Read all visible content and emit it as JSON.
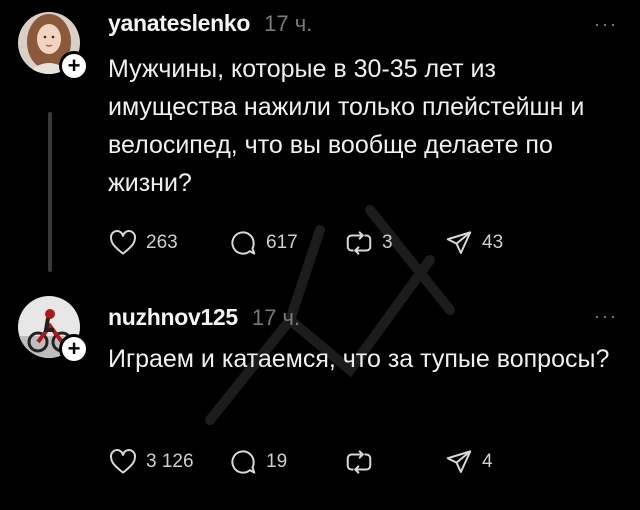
{
  "posts": [
    {
      "username": "yanateslenko",
      "time": "17 ч.",
      "text": "Мужчины, которые в 30-35 лет из имущества нажили только плейстейшн и велосипед, что вы вообще делаете по жизни?",
      "likes": "263",
      "replies": "617",
      "reposts": "3",
      "shares": "43"
    },
    {
      "username": "nuzhnov125",
      "time": "17 ч.",
      "text": "Играем и катаемся, что за тупые вопросы?",
      "likes": "3 126",
      "replies": "19",
      "reposts": "",
      "shares": "4"
    }
  ],
  "more_label": "···",
  "plus_label": "+",
  "icons": [
    "heart-icon",
    "comment-icon",
    "repost-icon",
    "share-icon",
    "more-icon",
    "follow-plus-icon"
  ],
  "colors": {
    "background": "#000000",
    "text": "#f0f0f0",
    "muted": "#7a7a7a",
    "thread_line": "#3a3a3a"
  }
}
